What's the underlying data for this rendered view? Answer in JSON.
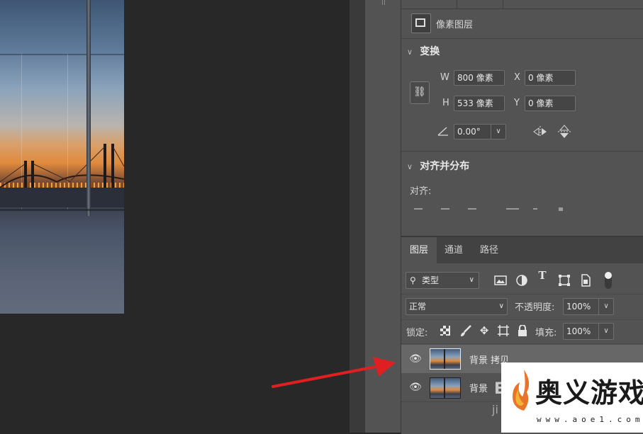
{
  "properties": {
    "layer_kind": "像素图层",
    "transform": {
      "title": "变换",
      "w_label": "W",
      "w_value": "800 像素",
      "x_label": "X",
      "x_value": "0 像素",
      "h_label": "H",
      "h_value": "533 像素",
      "y_label": "Y",
      "y_value": "0 像素",
      "angle_value": "0.00°"
    },
    "align": {
      "title": "对齐并分布",
      "label": "对齐:"
    }
  },
  "layers_panel": {
    "tabs": [
      "图层",
      "通道",
      "路径"
    ],
    "filter_label": "类型",
    "blend_mode": "正常",
    "opacity_label": "不透明度:",
    "opacity_value": "100%",
    "lock_label": "锁定:",
    "fill_label": "填充:",
    "fill_value": "100%",
    "layers": [
      {
        "name": "背景 拷贝",
        "selected": true
      },
      {
        "name": "背景",
        "selected": false
      }
    ]
  },
  "watermark": {
    "text": "奥义游戏网",
    "url": "www.aoe1.com",
    "ghost_a": "E",
    "ghost_b": "ji"
  },
  "colors": {
    "panel": "#535353",
    "canvas_bg": "#282828",
    "arrow": "#e02020"
  }
}
